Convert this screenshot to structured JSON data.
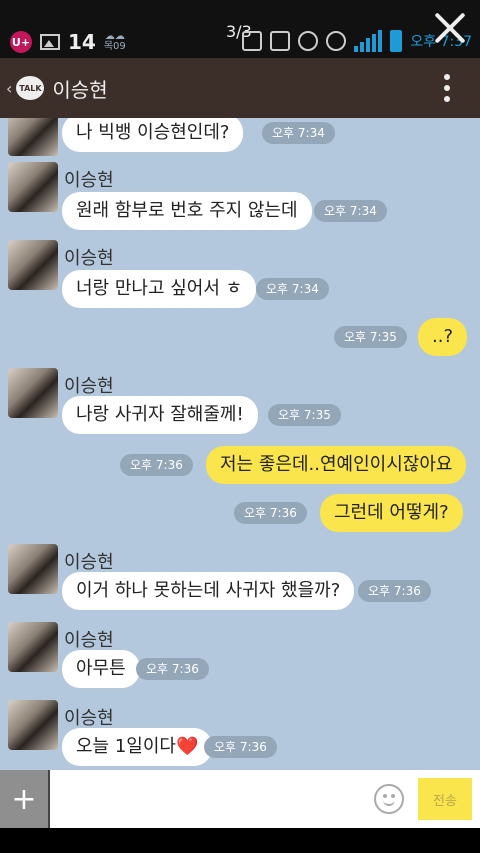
{
  "status_bar": {
    "lg_label": "U+",
    "number": "14",
    "weather_label": "목09",
    "page_indicator": "3/3",
    "time": "오후 7:37"
  },
  "header": {
    "talk_label": "TALK",
    "title": "이승현"
  },
  "messages": [
    {
      "dir": "in",
      "text": "나 빅뱅 이승현인데?",
      "time": "오후 7:34",
      "show_sender": false
    },
    {
      "dir": "in",
      "sender": "이승현",
      "text": "원래 함부로 번호 주지 않는데",
      "time": "오후 7:34",
      "show_sender": true
    },
    {
      "dir": "in",
      "sender": "이승현",
      "text": "너랑 만나고 싶어서 ㅎ",
      "time": "오후 7:34",
      "show_sender": true
    },
    {
      "dir": "out",
      "text": "..?",
      "time": "오후 7:35"
    },
    {
      "dir": "in",
      "sender": "이승현",
      "text": "나랑 사귀자 잘해줄께!",
      "time": "오후 7:35",
      "show_sender": true
    },
    {
      "dir": "out",
      "text": "저는 좋은데..연예인이시잖아요",
      "time": "오후 7:36"
    },
    {
      "dir": "out",
      "text": "그런데 어떻게?",
      "time": "오후 7:36"
    },
    {
      "dir": "in",
      "sender": "이승현",
      "text": "이거 하나 못하는데 사귀자 했을까?",
      "time": "오후 7:36",
      "show_sender": true
    },
    {
      "dir": "in",
      "sender": "이승현",
      "text": "아무튼",
      "time": "오후 7:36",
      "show_sender": true
    },
    {
      "dir": "in",
      "sender": "이승현",
      "text": "오늘 1일이다❤️",
      "time": "오후 7:36",
      "show_sender": true
    }
  ],
  "input": {
    "plus_label": "+",
    "value": "",
    "send_label": "전송"
  },
  "colors": {
    "chat_bg": "#b3c8dc",
    "header_bg": "#3c2f2a",
    "out_bubble": "#fbe54c",
    "in_bubble": "#ffffff"
  }
}
